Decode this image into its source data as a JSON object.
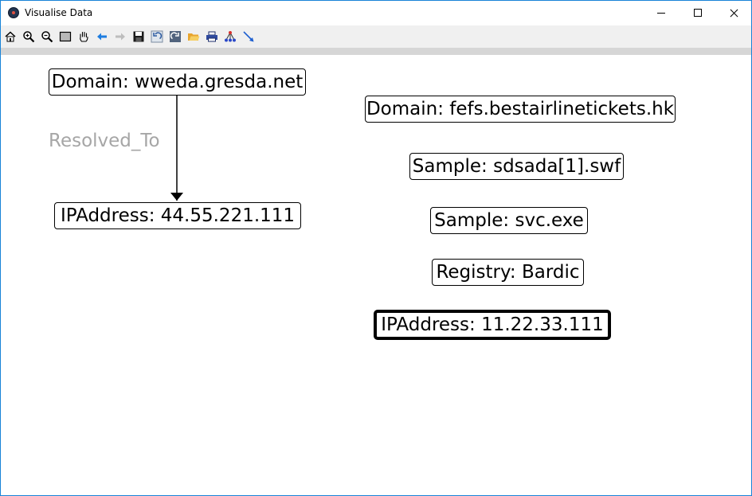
{
  "window": {
    "title": "Visualise Data",
    "controls": [
      "minimize",
      "maximize",
      "close"
    ]
  },
  "toolbar": {
    "tools": [
      {
        "name": "home-icon",
        "label": "Home"
      },
      {
        "name": "zoom-in-icon",
        "label": "Zoom in"
      },
      {
        "name": "zoom-out-icon",
        "label": "Zoom out"
      },
      {
        "name": "zoom-rect-icon",
        "label": "Zoom to rectangle"
      },
      {
        "name": "pan-hand-icon",
        "label": "Pan"
      },
      {
        "name": "back-arrow-icon",
        "label": "Back"
      },
      {
        "name": "forward-arrow-icon",
        "label": "Forward"
      },
      {
        "name": "save-icon",
        "label": "Save"
      },
      {
        "name": "undo-icon",
        "label": "Undo"
      },
      {
        "name": "redo-icon",
        "label": "Redo"
      },
      {
        "name": "open-folder-icon",
        "label": "Open"
      },
      {
        "name": "print-icon",
        "label": "Print"
      },
      {
        "name": "graph-layout-icon",
        "label": "Layout"
      },
      {
        "name": "pointer-arrow-icon",
        "label": "Select"
      }
    ]
  },
  "graph": {
    "nodes": [
      {
        "id": "n1",
        "label": "Domain: wweda.gresda.net",
        "selected": false
      },
      {
        "id": "n2",
        "label": "IPAddress: 44.55.221.111",
        "selected": false
      },
      {
        "id": "n3",
        "label": "Domain: fefs.bestairlinetickets.hk",
        "selected": false
      },
      {
        "id": "n4",
        "label": "Sample: sdsada[1].swf",
        "selected": false
      },
      {
        "id": "n5",
        "label": "Sample: svc.exe",
        "selected": false
      },
      {
        "id": "n6",
        "label": "Registry: Bardic",
        "selected": false
      },
      {
        "id": "n7",
        "label": "IPAddress: 11.22.33.111",
        "selected": true
      }
    ],
    "edges": [
      {
        "from": "n1",
        "to": "n2",
        "label": "Resolved_To"
      }
    ]
  },
  "colors": {
    "window_border": "#1883d7",
    "toolbar_bg": "#f0f0f0",
    "strip_bg": "#d6d6d6",
    "node_border": "#000000",
    "edge_label": "#a6a6a6"
  }
}
